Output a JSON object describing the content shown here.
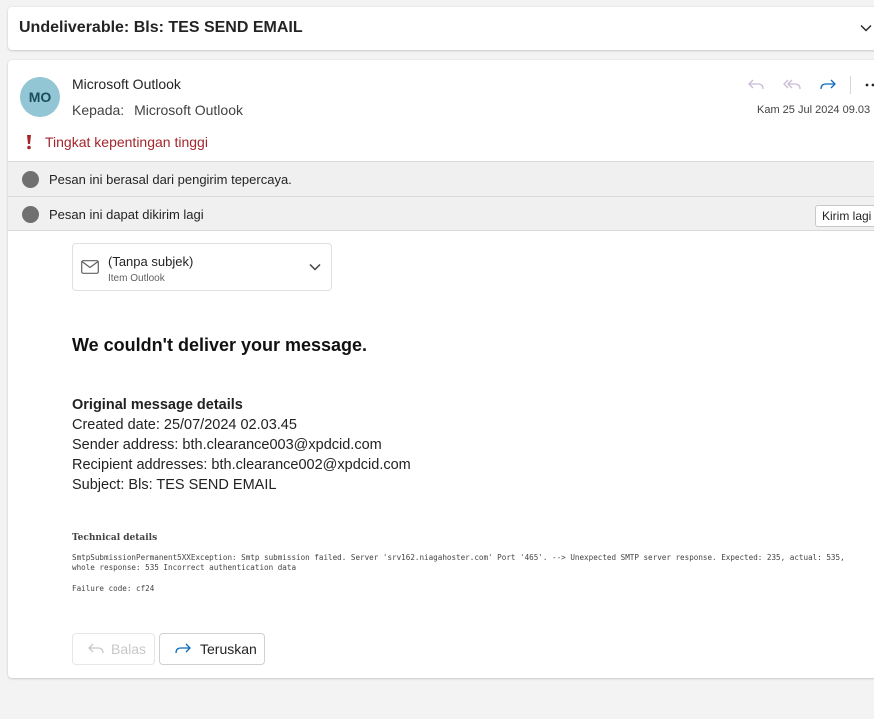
{
  "subject": {
    "title": "Undeliverable: Bls: TES SEND EMAIL"
  },
  "header": {
    "avatar_initials": "MO",
    "sender": "Microsoft Outlook",
    "to_label": "Kepada:",
    "to_value": "Microsoft Outlook",
    "date": "Kam 25 Jul 2024 09.03",
    "importance": "Tingkat kepentingan tinggi"
  },
  "info_bars": {
    "trusted": "Pesan ini berasal dari pengirim tepercaya.",
    "resend_text": "Pesan ini dapat dikirim lagi",
    "resend_button": "Kirim lagi"
  },
  "attachment": {
    "title": "(Tanpa subjek)",
    "subtitle": "Item Outlook"
  },
  "body": {
    "headline": "We couldn't deliver your message.",
    "details_title": "Original message details",
    "created": "Created date: 25/07/2024 02.03.45",
    "sender": "Sender address: bth.clearance003@xpdcid.com",
    "recipients": "Recipient addresses: bth.clearance002@xpdcid.com",
    "subject": "Subject: Bls: TES SEND EMAIL",
    "tech_title": "Technical details",
    "tech_text": "SmtpSubmissionPermanent5XXException: Smtp submission failed. Server 'srv162.niagahoster.com' Port '465'. --> Unexpected SMTP server response. Expected: 235, actual: 535, whole response: 535 Incorrect authentication data",
    "failure_code": "Failure code: cf24"
  },
  "footer": {
    "reply_label": "Balas",
    "forward_label": "Teruskan"
  },
  "colors": {
    "importance_red": "#a4262c",
    "avatar_bg": "#92c6d4",
    "accent_teal": "#0f6cbd"
  }
}
